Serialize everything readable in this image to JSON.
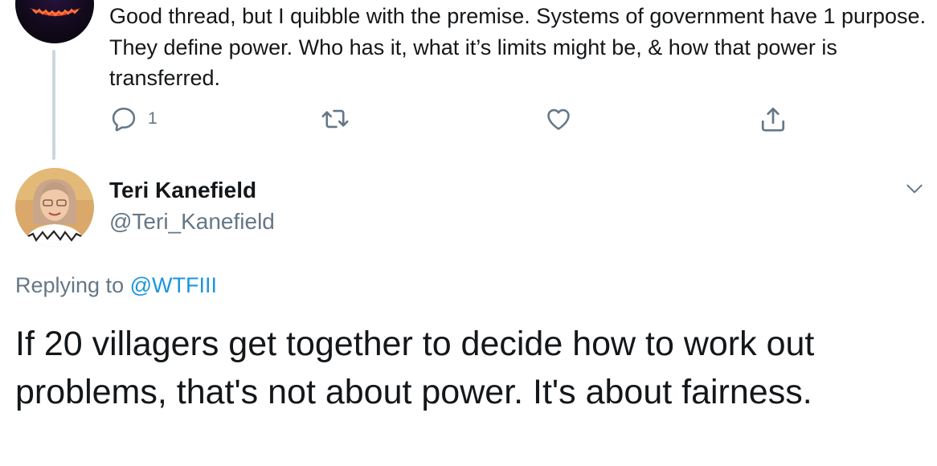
{
  "parent_tweet": {
    "text": "Good thread, but I quibble with the premise. Systems of government have 1 purpose. They define power. Who has it, what it’s limits might be, & how that power is transferred.",
    "reply_count": "1",
    "icons": [
      "reply-icon",
      "retweet-icon",
      "like-icon",
      "share-icon"
    ]
  },
  "tweet": {
    "author_name": "Teri Kanefield",
    "author_handle": "@Teri_Kanefield",
    "replying_prefix": "Replying to",
    "replying_to": "@WTFIII",
    "text": "If 20 villagers get together to decide how to work out problems, that's not about power. It's about fairness.",
    "menu_icon": "chevron-down-icon"
  },
  "colors": {
    "text": "#14171a",
    "secondary": "#657786",
    "link": "#1b95e0",
    "thread_line": "#ccd6dd"
  }
}
